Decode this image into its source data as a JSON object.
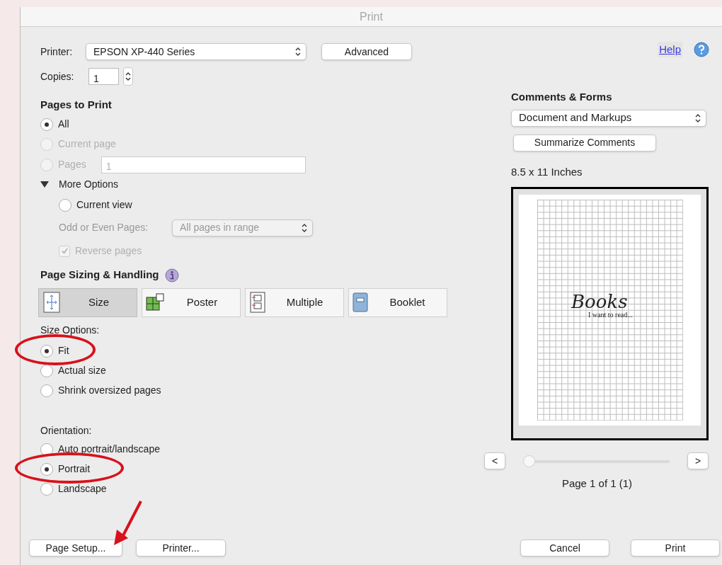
{
  "window": {
    "title": "Print"
  },
  "printer": {
    "label": "Printer:",
    "value": "EPSON XP-440 Series"
  },
  "advanced_button": "Advanced",
  "help_link": "Help",
  "copies": {
    "label": "Copies:",
    "value": "1"
  },
  "pages_to_print": {
    "heading": "Pages to Print",
    "options": [
      {
        "label": "All",
        "selected": true,
        "disabled": false
      },
      {
        "label": "Current page",
        "selected": false,
        "disabled": true
      },
      {
        "label": "Pages",
        "selected": false,
        "disabled": true
      }
    ],
    "pages_field": {
      "value": "1",
      "disabled": true
    }
  },
  "more_options": {
    "label": "More Options",
    "expanded": true,
    "current_view": {
      "label": "Current view",
      "selected": false
    },
    "odd_even": {
      "label": "Odd or Even Pages:",
      "value": "All pages in range",
      "disabled": true
    },
    "reverse_pages": {
      "label": "Reverse pages",
      "checked": true,
      "disabled": true
    }
  },
  "page_sizing": {
    "heading": "Page Sizing & Handling",
    "tabs": [
      {
        "kind": "size",
        "label": "Size",
        "selected": true
      },
      {
        "kind": "poster",
        "label": "Poster",
        "selected": false
      },
      {
        "kind": "multiple",
        "label": "Multiple",
        "selected": false
      },
      {
        "kind": "booklet",
        "label": "Booklet",
        "selected": false
      }
    ]
  },
  "size_options": {
    "label": "Size Options:",
    "options": [
      {
        "label": "Fit",
        "selected": true,
        "circled": true
      },
      {
        "label": "Actual size",
        "selected": false,
        "circled": false
      },
      {
        "label": "Shrink oversized pages",
        "selected": false,
        "circled": false
      }
    ]
  },
  "orientation": {
    "label": "Orientation:",
    "options": [
      {
        "label": "Auto portrait/landscape",
        "selected": false,
        "circled": false
      },
      {
        "label": "Portrait",
        "selected": true,
        "circled": true
      },
      {
        "label": "Landscape",
        "selected": false,
        "circled": false
      }
    ]
  },
  "comments_forms": {
    "heading": "Comments & Forms",
    "value": "Document and Markups",
    "summarize_button": "Summarize Comments"
  },
  "paper_size": "8.5 x 11 Inches",
  "preview": {
    "title": "Books",
    "subtitle": "I want to read..."
  },
  "page_slider": {
    "level": 0,
    "prev": "<",
    "next": ">"
  },
  "page_label": "Page 1 of 1 (1)",
  "footer": {
    "buttons": [
      {
        "label": "Page Setup...",
        "pointed": true
      },
      {
        "label": "Printer...",
        "pointed": false
      }
    ],
    "actions": [
      "Cancel",
      "Print"
    ]
  }
}
